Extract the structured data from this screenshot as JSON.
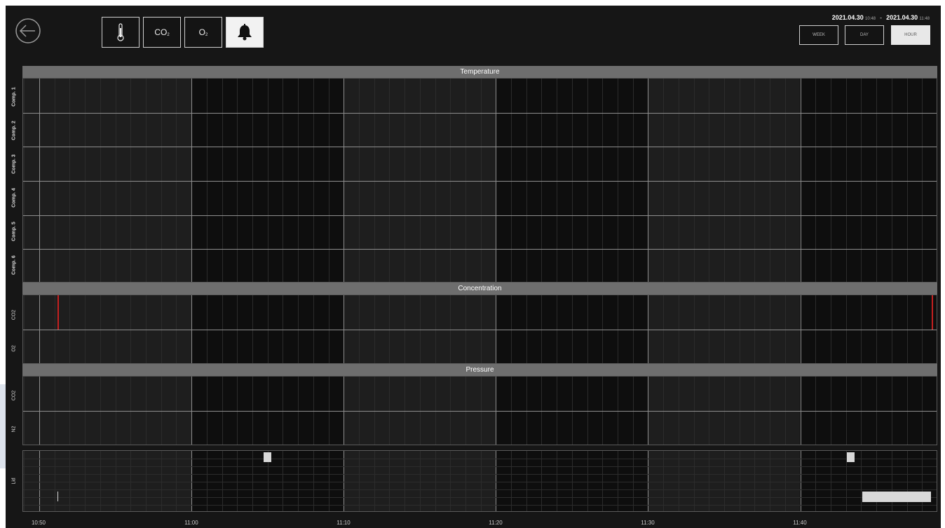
{
  "toolbar": {
    "buttons": [
      {
        "label": "",
        "icon": "thermometer-icon"
      },
      {
        "label": "CO",
        "sub": "2"
      },
      {
        "label": "O",
        "sub": "2"
      },
      {
        "label": "",
        "icon": "bell-icon",
        "active": true
      }
    ]
  },
  "range": {
    "start_date": "2021.04.30",
    "start_time": "10:48",
    "separator": "-",
    "end_date": "2021.04.30",
    "end_time": "11:48",
    "buttons": [
      {
        "label": "WEEK",
        "active": false
      },
      {
        "label": "DAY",
        "active": false
      },
      {
        "label": "HOUR",
        "active": true
      }
    ]
  },
  "sections": {
    "temperature": {
      "title": "Temperature",
      "rows": [
        "Comp. 1",
        "Comp. 2",
        "Comp. 3",
        "Comp. 4",
        "Comp. 5",
        "Comp. 6"
      ]
    },
    "concentration": {
      "title": "Concentration",
      "rows": [
        "CO2",
        "O2"
      ]
    },
    "pressure": {
      "title": "Pressure",
      "rows": [
        "CO2",
        "N2"
      ]
    },
    "lid": {
      "rows": [
        "Lid"
      ]
    }
  },
  "x_axis": {
    "ticks": [
      "10:50",
      "11:00",
      "11:10",
      "11:20",
      "11:30",
      "11:40"
    ]
  },
  "colors": {
    "background": "#161616",
    "alarm_marker": "#c42020",
    "section_header": "#6e6e6e"
  }
}
